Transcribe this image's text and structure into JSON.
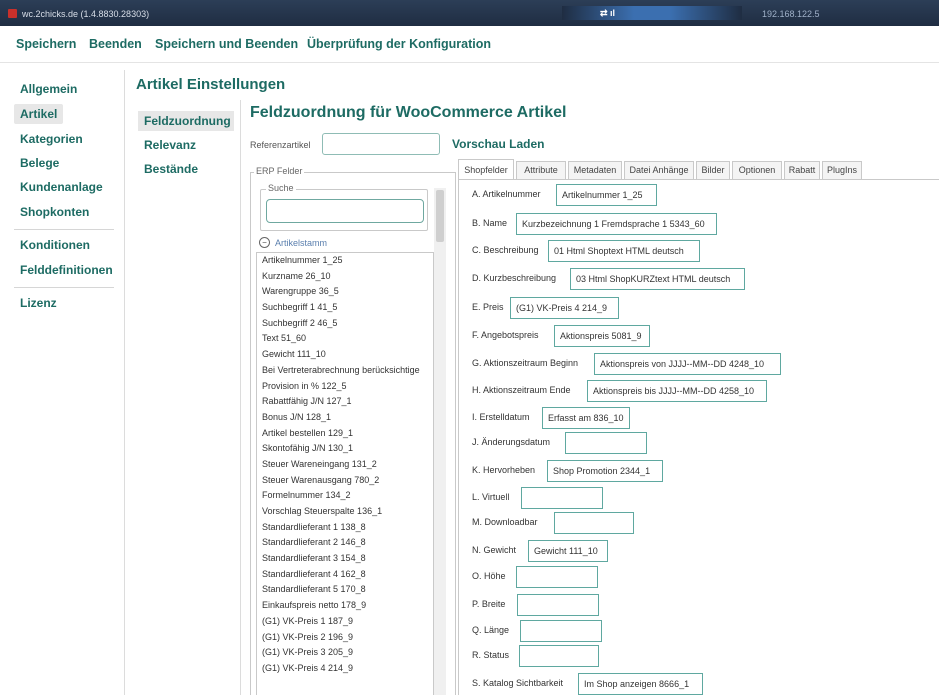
{
  "window": {
    "title": "wc.2chicks.de (1.4.8830.28303)",
    "ip": "192.168.122.5",
    "net_glyph": "⇄ ıl"
  },
  "menu": [
    "Speichern",
    "Beenden",
    "Speichern und Beenden",
    "Überprüfung der Konfiguration"
  ],
  "nav": [
    "Allgemein",
    "Artikel",
    "Kategorien",
    "Belege",
    "Kundenanlage",
    "Shopkonten",
    "Konditionen",
    "Felddefinitionen",
    "Lizenz"
  ],
  "section_title": "Artikel Einstellungen",
  "subnav": [
    "Feldzuordnung",
    "Relevanz",
    "Bestände"
  ],
  "main": {
    "title": "Feldzuordnung für WooCommerce Artikel",
    "ref_label": "Referenzartikel",
    "ref_value": "",
    "preview_load": "Vorschau Laden"
  },
  "erp": {
    "legend": "ERP Felder",
    "search_legend": "Suche",
    "search_value": "",
    "tree_label": "Artikelstamm",
    "items": [
      "Artikelnummer 1_25",
      "Kurzname 26_10",
      "Warengruppe 36_5",
      "Suchbegriff 1 41_5",
      "Suchbegriff 2 46_5",
      "Text 51_60",
      "Gewicht 111_10",
      "Bei Vertreterabrechnung berücksichtige",
      "Provision in % 122_5",
      "Rabattfähig J/N 127_1",
      "Bonus J/N 128_1",
      "Artikel bestellen 129_1",
      "Skontofähig J/N 130_1",
      "Steuer Wareneingang 131_2",
      "Steuer Warenausgang 780_2",
      "Formelnummer 134_2",
      "Vorschlag Steuerspalte 136_1",
      "Standardlieferant 1 138_8",
      "Standardlieferant 2 146_8",
      "Standardlieferant 3 154_8",
      "Standardlieferant 4 162_8",
      "Standardlieferant 5 170_8",
      "Einkaufspreis netto 178_9",
      "(G1) VK-Preis 1 187_9",
      "(G1) VK-Preis 2 196_9",
      "(G1) VK-Preis 3 205_9",
      "(G1) VK-Preis 4 214_9"
    ]
  },
  "tabs": [
    "Shopfelder",
    "Attribute",
    "Metadaten",
    "Datei Anhänge",
    "Bilder",
    "Optionen",
    "Rabatt",
    "PlugIns"
  ],
  "fields": [
    {
      "label": "A.  Artikelnummer",
      "value": "Artikelnummer 1_25"
    },
    {
      "label": "B.  Name",
      "value": "Kurzbezeichnung 1 Fremdsprache 1 5343_60"
    },
    {
      "label": "C.  Beschreibung",
      "value": "01 Html Shoptext HTML deutsch"
    },
    {
      "label": "D.  Kurzbeschreibung",
      "value": "03 Html ShopKURZtext HTML deutsch"
    },
    {
      "label": "E.  Preis",
      "value": "(G1) VK-Preis 4 214_9"
    },
    {
      "label": "F.  Angebotspreis",
      "value": "Aktionspreis 5081_9"
    },
    {
      "label": "G.  Aktionszeitraum Beginn",
      "value": "Aktionspreis von JJJJ--MM--DD 4248_10"
    },
    {
      "label": "H.  Aktionszeitraum Ende",
      "value": "Aktionspreis bis JJJJ--MM--DD 4258_10"
    },
    {
      "label": "I.  Erstelldatum",
      "value": "Erfasst am 836_10"
    },
    {
      "label": "J.  Änderungsdatum",
      "value": ""
    },
    {
      "label": "K.  Hervorheben",
      "value": "Shop Promotion 2344_1"
    },
    {
      "label": "L.  Virtuell",
      "value": ""
    },
    {
      "label": "M.  Downloadbar",
      "value": ""
    },
    {
      "label": "N.  Gewicht",
      "value": "Gewicht 111_10"
    },
    {
      "label": "O.  Höhe",
      "value": ""
    },
    {
      "label": "P.  Breite",
      "value": ""
    },
    {
      "label": "Q.  Länge",
      "value": ""
    },
    {
      "label": "R.  Status",
      "value": ""
    },
    {
      "label": "S.  Katalog Sichtbarkeit",
      "value": "Im Shop anzeigen 8666_1"
    }
  ]
}
